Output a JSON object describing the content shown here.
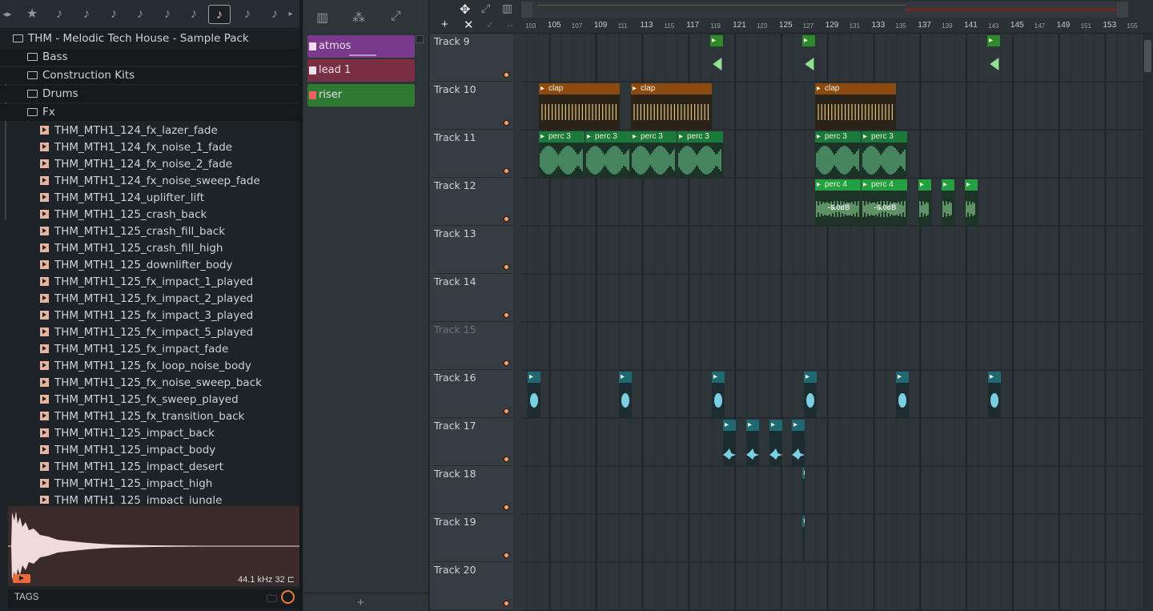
{
  "browser": {
    "toolbar_icons": [
      "chevron-left-right",
      "star",
      "note",
      "note",
      "note",
      "note",
      "note",
      "note",
      "note-selected",
      "note",
      "note",
      "chevron-right"
    ],
    "root": "THM - Melodic Tech House - Sample Pack",
    "folders": [
      "Bass",
      "Construction Kits",
      "Drums",
      "Fx"
    ],
    "files": [
      "THM_MTH1_124_fx_lazer_fade",
      "THM_MTH1_124_fx_noise_1_fade",
      "THM_MTH1_124_fx_noise_2_fade",
      "THM_MTH1_124_fx_noise_sweep_fade",
      "THM_MTH1_124_uplifter_lift",
      "THM_MTH1_125_crash_back",
      "THM_MTH1_125_crash_fill_back",
      "THM_MTH1_125_crash_fill_high",
      "THM_MTH1_125_downlifter_body",
      "THM_MTH1_125_fx_impact_1_played",
      "THM_MTH1_125_fx_impact_2_played",
      "THM_MTH1_125_fx_impact_3_played",
      "THM_MTH1_125_fx_impact_5_played",
      "THM_MTH1_125_fx_impact_fade",
      "THM_MTH1_125_fx_loop_noise_body",
      "THM_MTH1_125_fx_noise_sweep_back",
      "THM_MTH1_125_fx_sweep_played",
      "THM_MTH1_125_fx_transition_back",
      "THM_MTH1_125_impact_back",
      "THM_MTH1_125_impact_body",
      "THM_MTH1_125_impact_desert",
      "THM_MTH1_125_impact_high",
      "THM_MTH1_125_impact_jungle"
    ],
    "sample_info": "44.1 kHz 32",
    "tags_label": "TAGS"
  },
  "patterns": [
    {
      "name": "atmos",
      "color": "#7a3a8c"
    },
    {
      "name": "lead 1",
      "color": "#7a2e44"
    },
    {
      "name": "riser",
      "color": "#2e7a34"
    }
  ],
  "playlist": {
    "ruler_major": [
      "105",
      "109",
      "113",
      "117",
      "121",
      "125",
      "129",
      "133",
      "137",
      "141",
      "145",
      "149",
      "153"
    ],
    "ruler_minor": [
      "103",
      "107",
      "111",
      "115",
      "119",
      "123",
      "127",
      "131",
      "135",
      "139",
      "143",
      "147",
      "151",
      "155"
    ],
    "tracks": [
      "Track 9",
      "Track 10",
      "Track 11",
      "Track 12",
      "Track 13",
      "Track 14",
      "Track 15",
      "Track 16",
      "Track 17",
      "Track 18",
      "Track 19",
      "Track 20"
    ],
    "clip_labels": {
      "clap": "clap",
      "perc3": "perc 3",
      "perc4": "perc 4",
      "vol": "-6.0dB"
    },
    "colors": {
      "clap": "#8a4a10",
      "perc": "#1a7a3a",
      "perc_active": "#23a040",
      "teal": "#1f6a72",
      "green_fx": "#2e8a2a"
    }
  }
}
